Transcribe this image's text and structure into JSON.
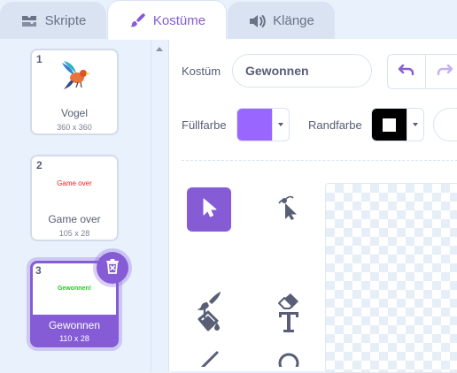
{
  "tabs": {
    "scripts": "Skripte",
    "costumes": "Kostüme",
    "sounds": "Klänge"
  },
  "costumes": [
    {
      "num": "1",
      "name": "Vogel",
      "size": "360 x 360",
      "thumb_text": ""
    },
    {
      "num": "2",
      "name": "Game over",
      "size": "105 x 28",
      "thumb_text": "Game over"
    },
    {
      "num": "3",
      "name": "Gewonnen",
      "size": "110 x 28",
      "thumb_text": "Gewonnen!"
    }
  ],
  "editor": {
    "costume_label": "Kostüm",
    "costume_name_value": "Gewonnen",
    "fill_label": "Füllfarbe",
    "outline_label": "Randfarbe"
  },
  "colors": {
    "accent": "#855cd6",
    "fill_color": "#9966ff",
    "outline_color": "#000000",
    "game_over_text": "#ff1a1a",
    "gewonnen_text": "#22cc22"
  },
  "tools": [
    "select-icon",
    "reshape-icon",
    "brush-icon",
    "eraser-icon",
    "fill-icon",
    "text-icon",
    "line-icon",
    "circle-icon"
  ]
}
